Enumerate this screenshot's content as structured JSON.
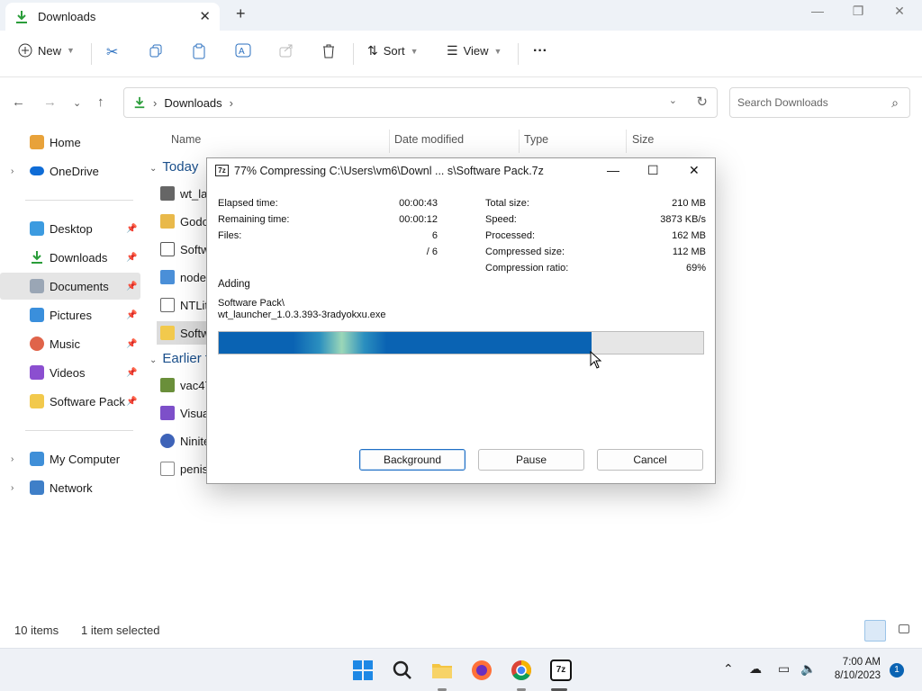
{
  "explorer": {
    "tab_title": "Downloads",
    "toolbar": {
      "new_label": "New",
      "sort_label": "Sort",
      "view_label": "View",
      "more_label": "···"
    },
    "address": {
      "segment": "Downloads"
    },
    "search": {
      "placeholder": "Search Downloads"
    },
    "sidebar": {
      "home": "Home",
      "onedrive": "OneDrive",
      "desktop": "Desktop",
      "downloads": "Downloads",
      "documents": "Documents",
      "pictures": "Pictures",
      "music": "Music",
      "videos": "Videos",
      "software_pack": "Software Pack",
      "my_computer": "My Computer",
      "network": "Network"
    },
    "columns": {
      "name": "Name",
      "date": "Date modified",
      "type": "Type",
      "size": "Size"
    },
    "groups": {
      "today": "Today",
      "earlier": "Earlier t"
    },
    "files_today": [
      "wt_lau",
      "Godot",
      "Softw",
      "node-",
      "NTLite",
      "Softw"
    ],
    "files_earlier": [
      "vac47",
      "Visual",
      "Ninite",
      "penis"
    ],
    "status": {
      "items": "10 items",
      "selected": "1 item selected"
    }
  },
  "dialog": {
    "icon_text": "7z",
    "title": "77% Compressing C:\\Users\\vm6\\Downl ... s\\Software Pack.7z",
    "left_labels": {
      "elapsed": "Elapsed time:",
      "remaining": "Remaining time:",
      "files": "Files:"
    },
    "left_values": {
      "elapsed": "00:00:43",
      "remaining": "00:00:12",
      "files": "6",
      "files_total": "/ 6"
    },
    "right_labels": {
      "total": "Total size:",
      "speed": "Speed:",
      "processed": "Processed:",
      "compressed": "Compressed size:",
      "ratio": "Compression ratio:"
    },
    "right_values": {
      "total": "210 MB",
      "speed": "3873 KB/s",
      "processed": "162 MB",
      "compressed": "112 MB",
      "ratio": "69%"
    },
    "action": "Adding",
    "path_line1": "Software Pack\\",
    "path_line2": "wt_launcher_1.0.3.393-3radyokxu.exe",
    "progress": 0.77,
    "buttons": {
      "background": "Background",
      "pause": "Pause",
      "cancel": "Cancel"
    }
  },
  "taskbar": {
    "time": "7:00 AM",
    "date": "8/10/2023",
    "notification_count": "1"
  }
}
